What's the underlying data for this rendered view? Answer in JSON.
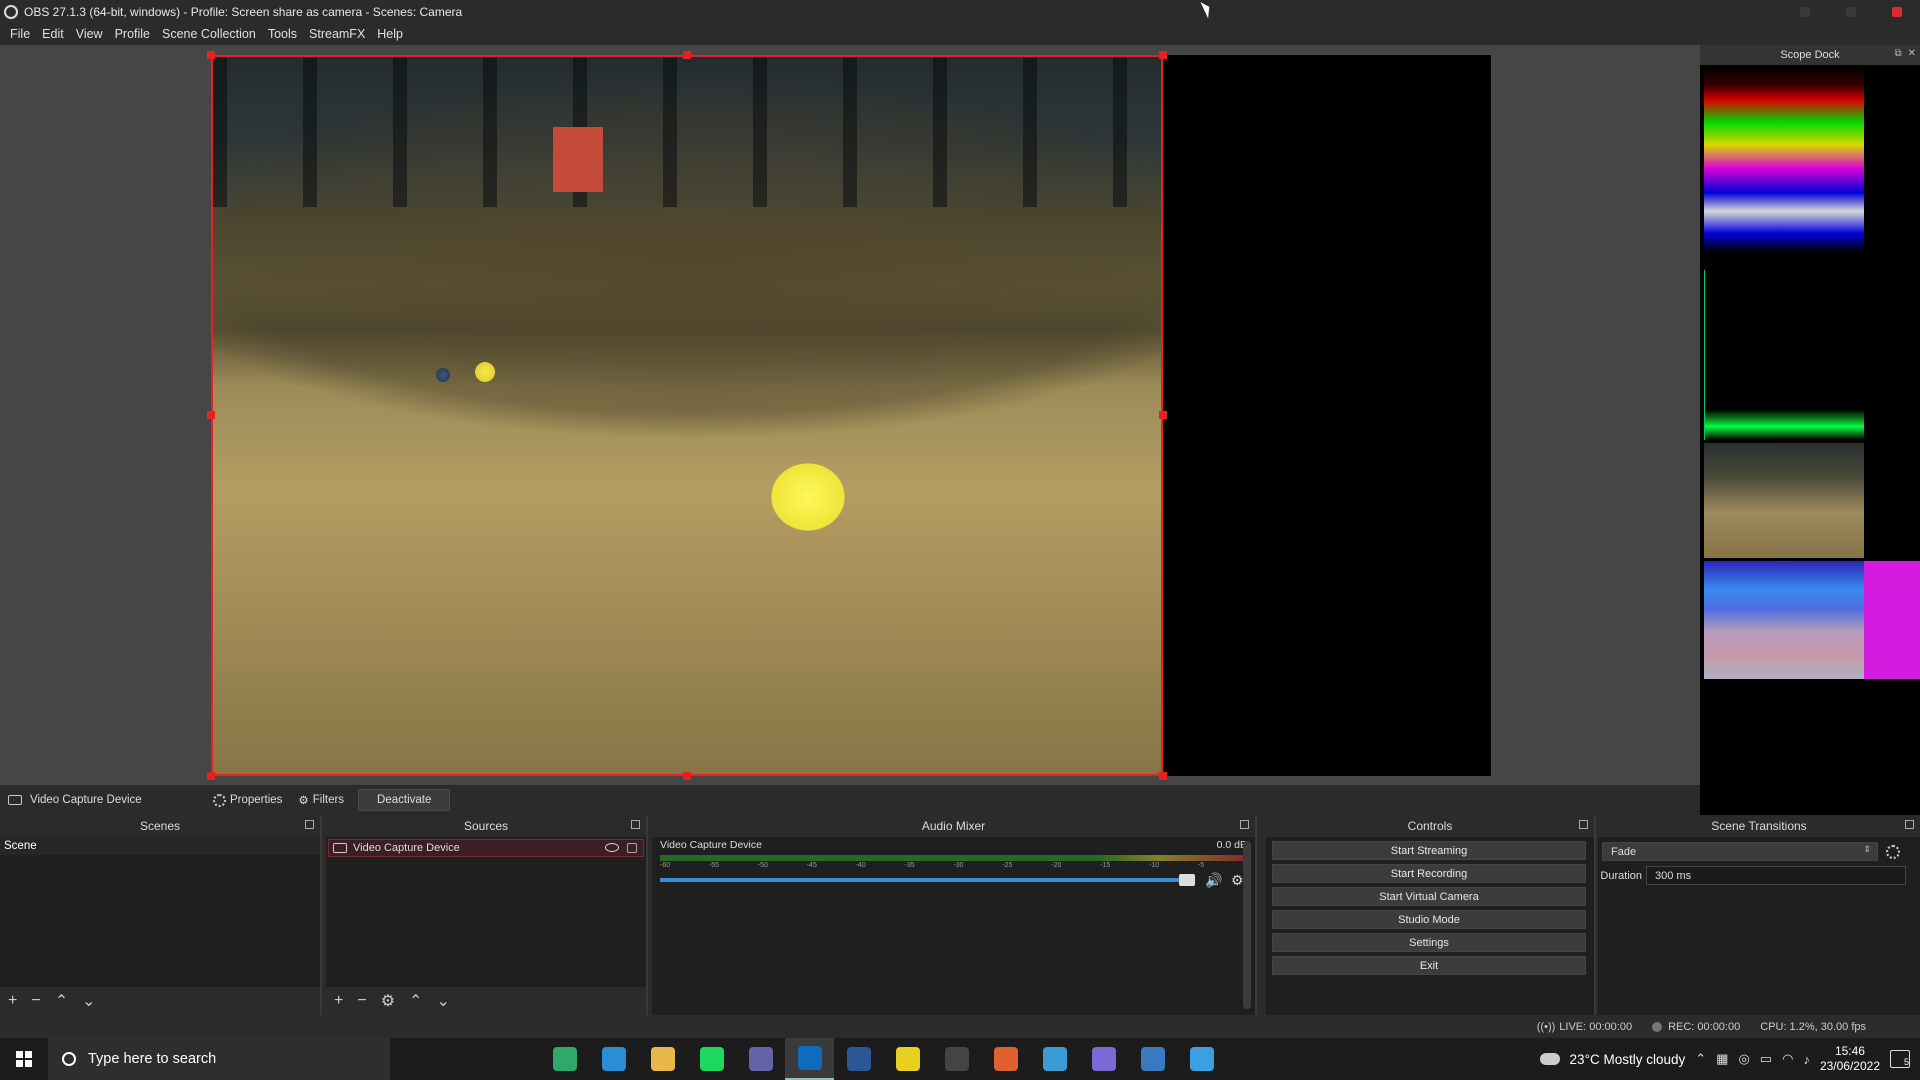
{
  "window": {
    "title": "OBS 27.1.3 (64-bit, windows) - Profile: Screen share as camera - Scenes: Camera"
  },
  "menu": [
    "File",
    "Edit",
    "View",
    "Profile",
    "Scene Collection",
    "Tools",
    "StreamFX",
    "Help"
  ],
  "scope_dock": {
    "title": "Scope Dock"
  },
  "source_toolbar": {
    "source_name": "Video Capture Device",
    "properties": "Properties",
    "filters": "Filters",
    "deactivate": "Deactivate"
  },
  "scenes": {
    "title": "Scenes",
    "items": [
      "Scene"
    ]
  },
  "sources": {
    "title": "Sources",
    "items": [
      "Video Capture Device"
    ]
  },
  "audio_mixer": {
    "title": "Audio Mixer",
    "channel": "Video Capture Device",
    "level": "0.0 dB",
    "ticks": [
      "-60",
      "-55",
      "-50",
      "-45",
      "-40",
      "-35",
      "-30",
      "-25",
      "-20",
      "-15",
      "-10",
      "-5",
      "0"
    ]
  },
  "controls": {
    "title": "Controls",
    "buttons": [
      "Start Streaming",
      "Start Recording",
      "Start Virtual Camera",
      "Studio Mode",
      "Settings",
      "Exit"
    ]
  },
  "transitions": {
    "title": "Scene Transitions",
    "selected": "Fade",
    "duration_label": "Duration",
    "duration_value": "300 ms"
  },
  "status": {
    "live": "LIVE: 00:00:00",
    "rec": "REC: 00:00:00",
    "cpu": "CPU: 1.2%, 30.00 fps"
  },
  "taskbar": {
    "search_placeholder": "Type here to search",
    "weather": "23°C  Mostly cloudy",
    "time": "15:46",
    "date": "23/06/2022",
    "notifications": "5",
    "apps": [
      {
        "name": "edge-dev-icon",
        "color": "#2fa86a"
      },
      {
        "name": "vscode-icon",
        "color": "#2a8ed6"
      },
      {
        "name": "file-explorer-icon",
        "color": "#e8b84a"
      },
      {
        "name": "spotify-icon",
        "color": "#1ed760"
      },
      {
        "name": "teams-icon",
        "color": "#6264a7"
      },
      {
        "name": "outlook-icon",
        "color": "#0f6cbd"
      },
      {
        "name": "word-icon",
        "color": "#2b5797"
      },
      {
        "name": "app-yellow-icon",
        "color": "#e8d020"
      },
      {
        "name": "obs-icon",
        "color": "#444444"
      },
      {
        "name": "app-orange-icon",
        "color": "#e06030"
      },
      {
        "name": "app-blue-icon",
        "color": "#3a9ad6"
      },
      {
        "name": "app-purple-icon",
        "color": "#7a6ad6"
      },
      {
        "name": "python-icon",
        "color": "#3a7ac0"
      },
      {
        "name": "network-app-icon",
        "color": "#3aa0e0"
      }
    ]
  }
}
